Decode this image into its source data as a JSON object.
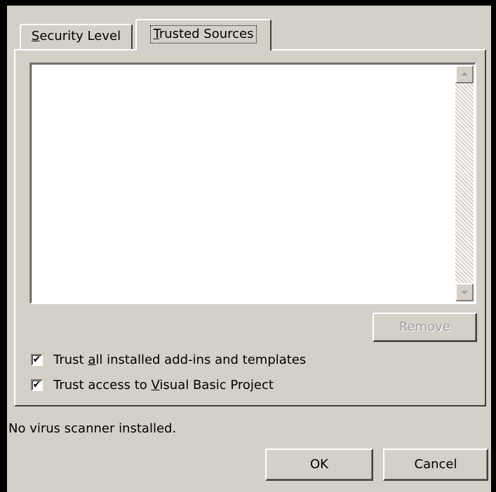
{
  "tabs": [
    {
      "label": "Security Level",
      "mnemonic": "S",
      "rest": "ecurity Level",
      "selected": false
    },
    {
      "label": "Trusted Sources",
      "mnemonic": "T",
      "rest": "rusted Sources",
      "selected": true
    }
  ],
  "trusted_sources_list": [],
  "remove_button": {
    "label": "Remove",
    "enabled": false
  },
  "checkboxes": [
    {
      "label": "Trust all installed add-ins and templates",
      "pre": "Trust ",
      "mnemonic": "a",
      "post": "ll installed add-ins and templates",
      "checked": true
    },
    {
      "label": "Trust access to Visual Basic Project",
      "pre": "Trust access to ",
      "mnemonic": "V",
      "post": "isual Basic Project",
      "checked": true
    }
  ],
  "status_text": "No virus scanner installed.",
  "buttons": {
    "ok": "OK",
    "cancel": "Cancel"
  },
  "check_glyph": "✔",
  "colors": {
    "face": "#d4d0c8",
    "disabled_text": "#a0a0a0",
    "window": "#ffffff"
  }
}
